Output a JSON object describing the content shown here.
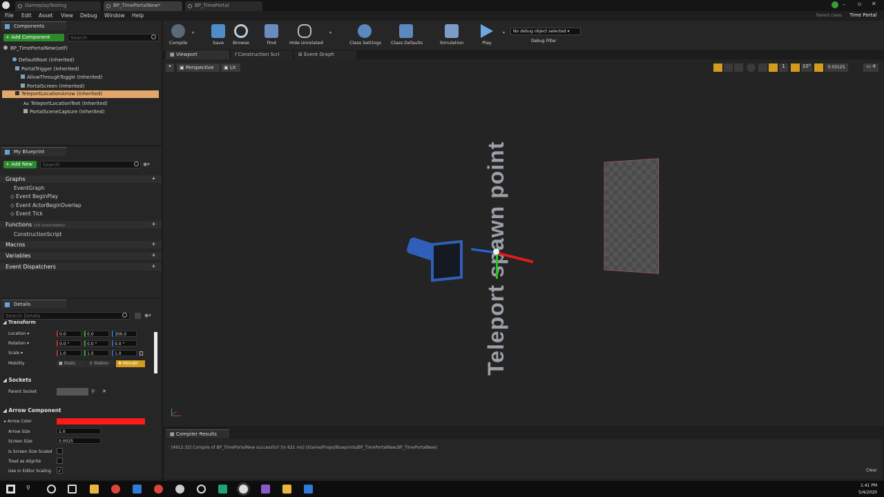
{
  "title_tabs": [
    "GameplayTesting",
    "BP_TimePortalNew*",
    "BP_TimePortal"
  ],
  "title_right": {
    "parent_class_label": "Parent class:",
    "parent_class": "Time Portal"
  },
  "menu": [
    "File",
    "Edit",
    "Asset",
    "View",
    "Debug",
    "Window",
    "Help"
  ],
  "toolbar": {
    "compile": "Compile",
    "save": "Save",
    "browse": "Browse",
    "find": "Find",
    "hide_unrelated": "Hide Unrelated",
    "class_settings": "Class Settings",
    "class_defaults": "Class Defaults",
    "simulation": "Simulation",
    "play": "Play",
    "debug_select": "No debug object selected",
    "debug_filter": "Debug Filter"
  },
  "components": {
    "tab": "Components",
    "add_button": "+ Add Component",
    "search_placeholder": "Search",
    "root": "BP_TimePortalNew(self)",
    "items": [
      "DefaultRoot (Inherited)",
      "PortalTrigger (Inherited)",
      "AllowThroughToggle (Inherited)",
      "PortalScreen (Inherited)",
      "TeleportLocationArrow (Inherited)",
      "TeleportLocationText (Inherited)",
      "PortalSceneCapture (Inherited)"
    ]
  },
  "my_blueprint": {
    "tab": "My Blueprint",
    "add_button": "+ Add New",
    "search_placeholder": "Search",
    "graphs": "Graphs",
    "event_graph": "EventGraph",
    "events": [
      "Event BeginPlay",
      "Event ActorBeginOverlap",
      "Event Tick"
    ],
    "functions": "Functions",
    "functions_count": "(16 Overridable)",
    "construction_script": "ConstructionScript",
    "macros": "Macros",
    "variables": "Variables",
    "event_dispatchers": "Event Dispatchers"
  },
  "details": {
    "tab": "Details",
    "search_placeholder": "Search Details",
    "transform": "Transform",
    "location_label": "Location",
    "location": [
      "0.0",
      "0.0",
      "300.0"
    ],
    "rotation_label": "Rotation",
    "rotation": [
      "0.0 °",
      "0.0 °",
      "0.0 °"
    ],
    "scale_label": "Scale",
    "scale": [
      "1.0",
      "1.0",
      "1.0"
    ],
    "mobility_label": "Mobility",
    "mobility": [
      "Static",
      "Station",
      "Movabl"
    ],
    "sockets": "Sockets",
    "parent_socket": "Parent Socket",
    "arrow_component": "Arrow Component",
    "arrow_color": "Arrow Color",
    "arrow_color_value": "#ff1a1a",
    "arrow_size": "Arrow Size",
    "arrow_size_value": "1.0",
    "screen_size": "Screen Size",
    "screen_size_value": "0.0025",
    "is_screen_size_scaled": "Is Screen Size Scaled",
    "treat_as_asprite": "Treat as ASprite",
    "use_in_editor_scaling": "Use in Editor Scaling"
  },
  "editor_tabs": [
    "Viewport",
    "Construction Scri",
    "Event Graph"
  ],
  "viewport": {
    "perspective": "Perspective",
    "lit": "Lit",
    "grid_snap": "10°",
    "rot_snap": "10°",
    "scale_snap": "0.03125",
    "cam_speed": "4",
    "num1": "1",
    "text3d": "Teleport spawn point"
  },
  "compiler": {
    "tab": "Compiler Results",
    "message": "[4912.32] Compile of BP_TimePortalNew successful! [in 621 ms] (/Game/Props/Blueprints/BP_TimePortalNew.BP_TimePortalNew)",
    "clear": "Clear"
  },
  "clock": {
    "time": "1:41 PM",
    "date": "5/4/2020"
  },
  "colors": {
    "accent_green": "#2b8a2b",
    "selection": "#e2a86b",
    "movable": "#d59b1e"
  }
}
